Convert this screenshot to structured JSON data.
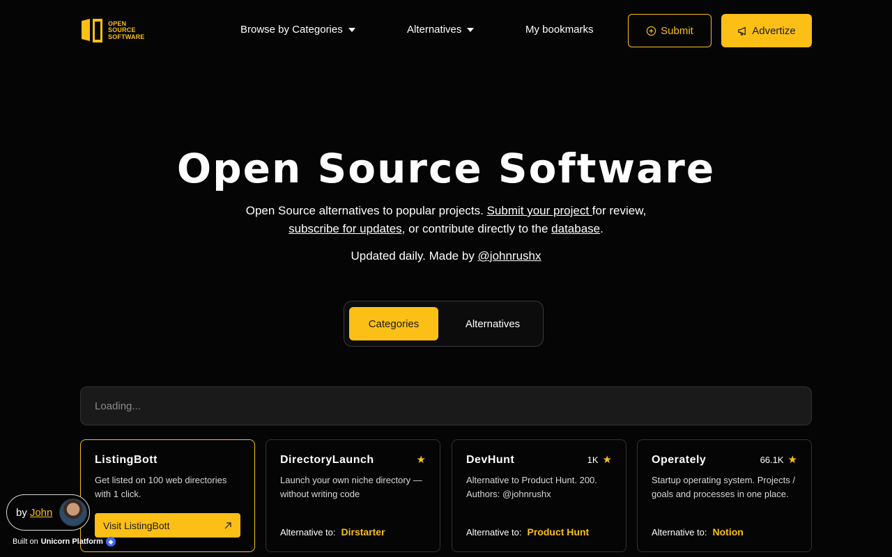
{
  "header": {
    "logo_lines": [
      "OPEN",
      "SOURCE",
      "SOFTWARE"
    ],
    "nav": {
      "browse_categories": "Browse by Categories",
      "alternatives": "Alternatives",
      "bookmarks": "My bookmarks"
    },
    "submit_label": "Submit",
    "advertize_label": "Advertize"
  },
  "hero": {
    "title": "Open Source Software",
    "line1_prefix": "Open Source alternatives to popular projects. ",
    "submit_link": "Submit your project ",
    "line1_suffix": "for review,",
    "subscribe_link": "subscribe for updates",
    "line2_middle": ", or contribute directly to the ",
    "database_link": "database",
    "line2_suffix": ".",
    "updated_prefix": "Updated daily. Made by ",
    "author_handle": "@johnrushx"
  },
  "tabs": {
    "categories": "Categories",
    "alternatives": "Alternatives"
  },
  "search": {
    "placeholder": "Loading..."
  },
  "cards": [
    {
      "title": "ListingBott",
      "description": "Get listed on 100 web directories with 1 click.",
      "cta": "Visit ListingBott"
    },
    {
      "title": "DirectoryLaunch",
      "stars": "",
      "description": "Launch your own niche directory — without writing code",
      "alt_label": "Alternative to:",
      "alt_name": "Dirstarter"
    },
    {
      "title": "DevHunt",
      "stars": "1K",
      "description": "Alternative to Product Hunt. 200. Authors: @johnrushx",
      "alt_label": "Alternative to:",
      "alt_name": "Product Hunt"
    },
    {
      "title": "Operately",
      "stars": "66.1K",
      "description": "Startup operating system. Projects / goals and processes in one place.",
      "alt_label": "Alternative to:",
      "alt_name": "Notion"
    }
  ],
  "badge": {
    "by": "by",
    "name": "John",
    "built_on": "Built on",
    "platform": "Unicorn Platform"
  },
  "colors": {
    "accent": "#fcbf16",
    "background": "#050505"
  }
}
